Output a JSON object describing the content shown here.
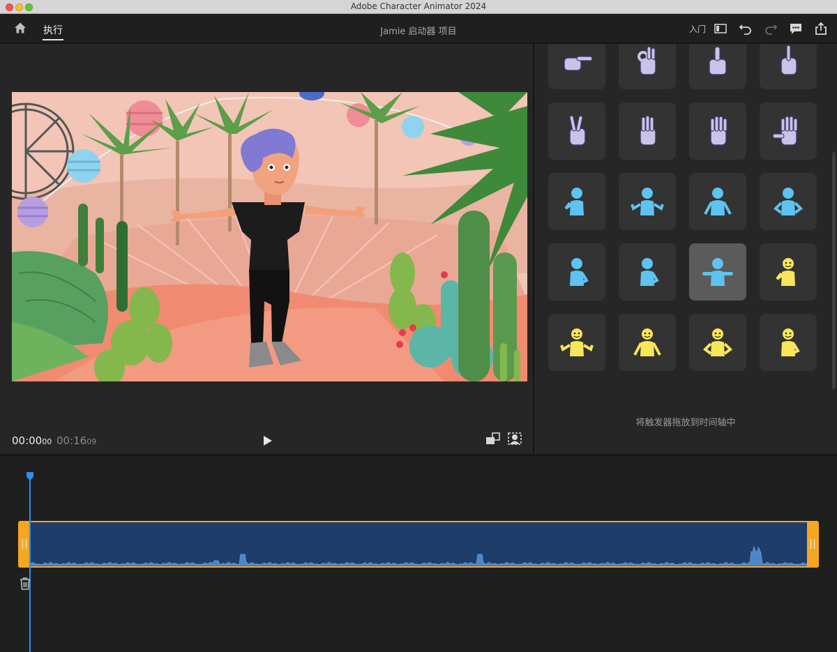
{
  "window": {
    "title": "Adobe Character Animator 2024"
  },
  "header": {
    "active_tab": "执行",
    "project_title": "Jamie 启动器 项目",
    "learn_label": "入门"
  },
  "stage": {
    "time_current": "00:00",
    "time_current_frames": "00",
    "time_total": "00:16",
    "time_total_frames": "09"
  },
  "triggers": {
    "drop_hint": "将触发器拖放到时间轴中",
    "selected_index": 14,
    "items": [
      {
        "icon": "pointing-hand-icon",
        "color": "#c9c3e8"
      },
      {
        "icon": "ok-hand-icon",
        "color": "#c9c3e8"
      },
      {
        "icon": "thumbs-up-icon",
        "color": "#c9c3e8"
      },
      {
        "icon": "one-finger-hand-icon",
        "color": "#c9c3e8"
      },
      {
        "icon": "peace-sign-hand-icon",
        "color": "#c9c3e8"
      },
      {
        "icon": "three-fingers-hand-icon",
        "color": "#c9c3e8"
      },
      {
        "icon": "four-fingers-hand-icon",
        "color": "#c9c3e8"
      },
      {
        "icon": "open-palm-hand-icon",
        "color": "#c9c3e8"
      },
      {
        "icon": "pose-hand-on-chin-icon",
        "color": "#5ec3f0"
      },
      {
        "icon": "pose-shrug-icon",
        "color": "#5ec3f0"
      },
      {
        "icon": "pose-arms-down-icon",
        "color": "#5ec3f0"
      },
      {
        "icon": "pose-hands-on-hips-icon",
        "color": "#5ec3f0"
      },
      {
        "icon": "pose-side-hand-on-hip-icon",
        "color": "#5ec3f0"
      },
      {
        "icon": "pose-side-arm-icon",
        "color": "#5ec3f0"
      },
      {
        "icon": "pose-t-pose-icon",
        "color": "#5ec3f0"
      },
      {
        "icon": "pose-smile-hand-on-chin-icon",
        "color": "#f7e65a"
      },
      {
        "icon": "pose-smile-shrug-icon",
        "color": "#f7e65a"
      },
      {
        "icon": "pose-smile-arms-down-icon",
        "color": "#f7e65a"
      },
      {
        "icon": "pose-smile-hands-on-hips-icon",
        "color": "#f7e65a"
      },
      {
        "icon": "pose-smile-side-icon",
        "color": "#f7e65a"
      }
    ]
  },
  "timeline": {
    "playhead_position": 0,
    "clip_color": "#f5a623",
    "waveform_color": "#4a86c8"
  },
  "colors": {
    "accent_blue": "#2e8ff0",
    "clip_orange": "#f5a623",
    "selected_tile": "#5b5b5b"
  }
}
